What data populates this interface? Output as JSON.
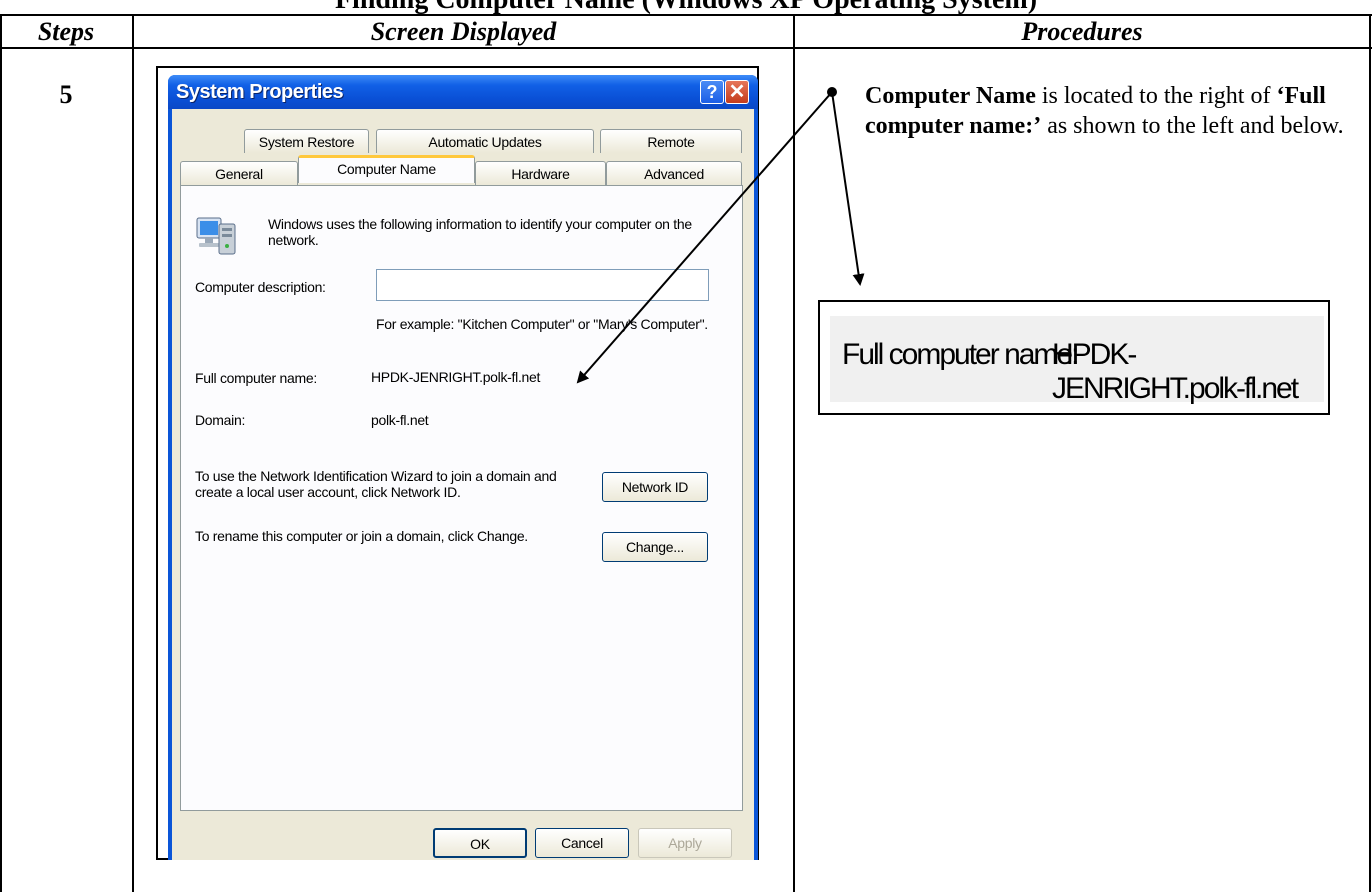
{
  "document": {
    "title_partial": "Finding Computer Name (Windows XP Operating System)",
    "headers": {
      "steps": "Steps",
      "screen": "Screen Displayed",
      "procedures": "Procedures"
    },
    "step_number": "5"
  },
  "dialog": {
    "title": "System Properties",
    "help_glyph": "?",
    "close_glyph": "✕",
    "tabs_row1": [
      "System Restore",
      "Automatic Updates",
      "Remote"
    ],
    "tabs_row2": [
      "General",
      "Computer Name",
      "Hardware",
      "Advanced"
    ],
    "active_tab": "Computer Name",
    "intro": "Windows uses the following information to identify your computer on the network.",
    "description_label": "Computer description:",
    "description_value": "",
    "example": "For example: \"Kitchen Computer\" or \"Mary's Computer\".",
    "full_name_label": "Full computer name:",
    "full_name_value": "HPDK-JENRIGHT.polk-fl.net",
    "domain_label": "Domain:",
    "domain_value": "polk-fl.net",
    "network_id_text": "To use the Network Identification Wizard to join a domain and create a local user account, click Network ID.",
    "network_id_button": "Network ID",
    "rename_text": "To rename this computer or join a domain, click Change.",
    "change_button": "Change...",
    "ok_button": "OK",
    "cancel_button": "Cancel",
    "apply_button": "Apply"
  },
  "procedures": {
    "part1_bold": "Computer Name",
    "part2": " is located to the right of ",
    "part3_bold": "‘Full computer name:’",
    "part4": " as shown to the left and below."
  },
  "zoom": {
    "label": "Full computer name:",
    "value": "HPDK-JENRIGHT.polk-fl.net"
  },
  "colors": {
    "xp_blue": "#0a55d8",
    "dialog_face": "#ece9d8",
    "active_tab_accent": "#ffc83c"
  }
}
